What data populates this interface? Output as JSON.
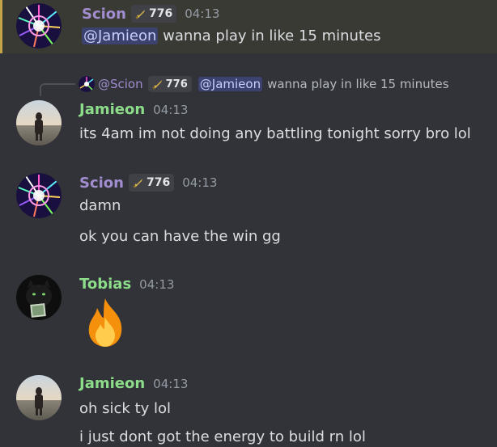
{
  "colors": {
    "scion": "#a18dcf",
    "jamieon": "#8ddc8a",
    "tobias": "#8ddc8a",
    "mention_bg": "#3c4270",
    "background": "#313338"
  },
  "messages": [
    {
      "author": "Scion",
      "badge": "776",
      "time": "04:13",
      "mention": "@Jamieon",
      "text": "wanna play in like 15 minutes"
    },
    {
      "reply": {
        "author": "@Scion",
        "badge": "776",
        "mention": "@Jamieon",
        "text": "wanna play in like 15 minutes"
      },
      "author": "Jamieon",
      "time": "04:13",
      "text": "its 4am im not doing any battling tonight sorry bro lol"
    },
    {
      "author": "Scion",
      "badge": "776",
      "time": "04:13",
      "lines": [
        "damn",
        "ok you can have the win gg"
      ]
    },
    {
      "author": "Tobias",
      "time": "04:13",
      "emoji": "fire-emoji"
    },
    {
      "author": "Jamieon",
      "time": "04:13",
      "lines": [
        "oh sick ty lol",
        "i just dont got the energy to build rn lol"
      ]
    }
  ]
}
